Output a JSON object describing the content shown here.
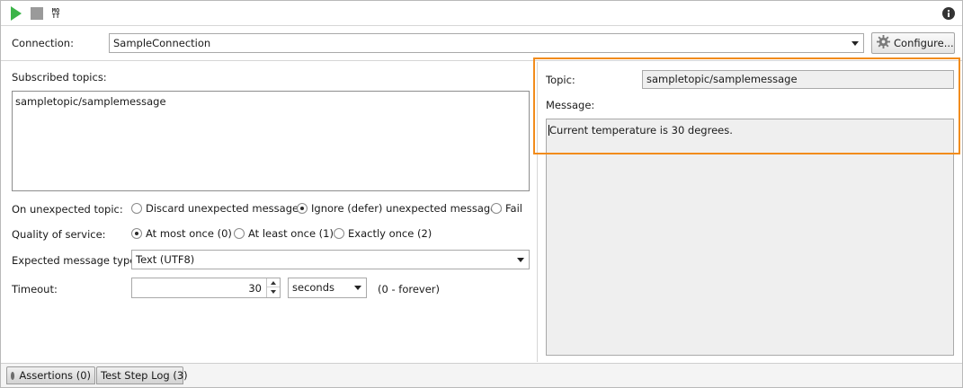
{
  "toolbar": {
    "run_icon": "play-icon",
    "stop_icon": "stop-icon",
    "mqtt_icon": "mqtt-icon",
    "mqtt_top": "MQ",
    "mqtt_bottom": "TT",
    "info_icon": "info-icon",
    "accent_run": "#3cb449"
  },
  "connection": {
    "label": "Connection:",
    "value": "SampleConnection",
    "configure_label": "Configure..."
  },
  "subscribed": {
    "label": "Subscribed topics:",
    "topics": "sampletopic/samplemessage"
  },
  "unexpected": {
    "label": "On unexpected topic:",
    "options": [
      "Discard unexpected messages",
      "Ignore (defer) unexpected messages",
      "Fail"
    ],
    "selected_index": 1
  },
  "qos": {
    "label": "Quality of service:",
    "options": [
      "At most once (0)",
      "At least once (1)",
      "Exactly once (2)"
    ],
    "selected_index": 0
  },
  "message_type": {
    "label": "Expected message type:",
    "value": "Text (UTF8)"
  },
  "timeout": {
    "label": "Timeout:",
    "value": "30",
    "unit": "seconds",
    "hint": "(0 - forever)"
  },
  "result": {
    "topic_label": "Topic:",
    "topic_value": "sampletopic/samplemessage",
    "message_label": "Message:",
    "message_value": "Current temperature is 30 degrees.",
    "highlight_color": "#f28c1c"
  },
  "tabs": [
    {
      "label": "Assertions (0)"
    },
    {
      "label": "Test Step Log (3)"
    }
  ]
}
